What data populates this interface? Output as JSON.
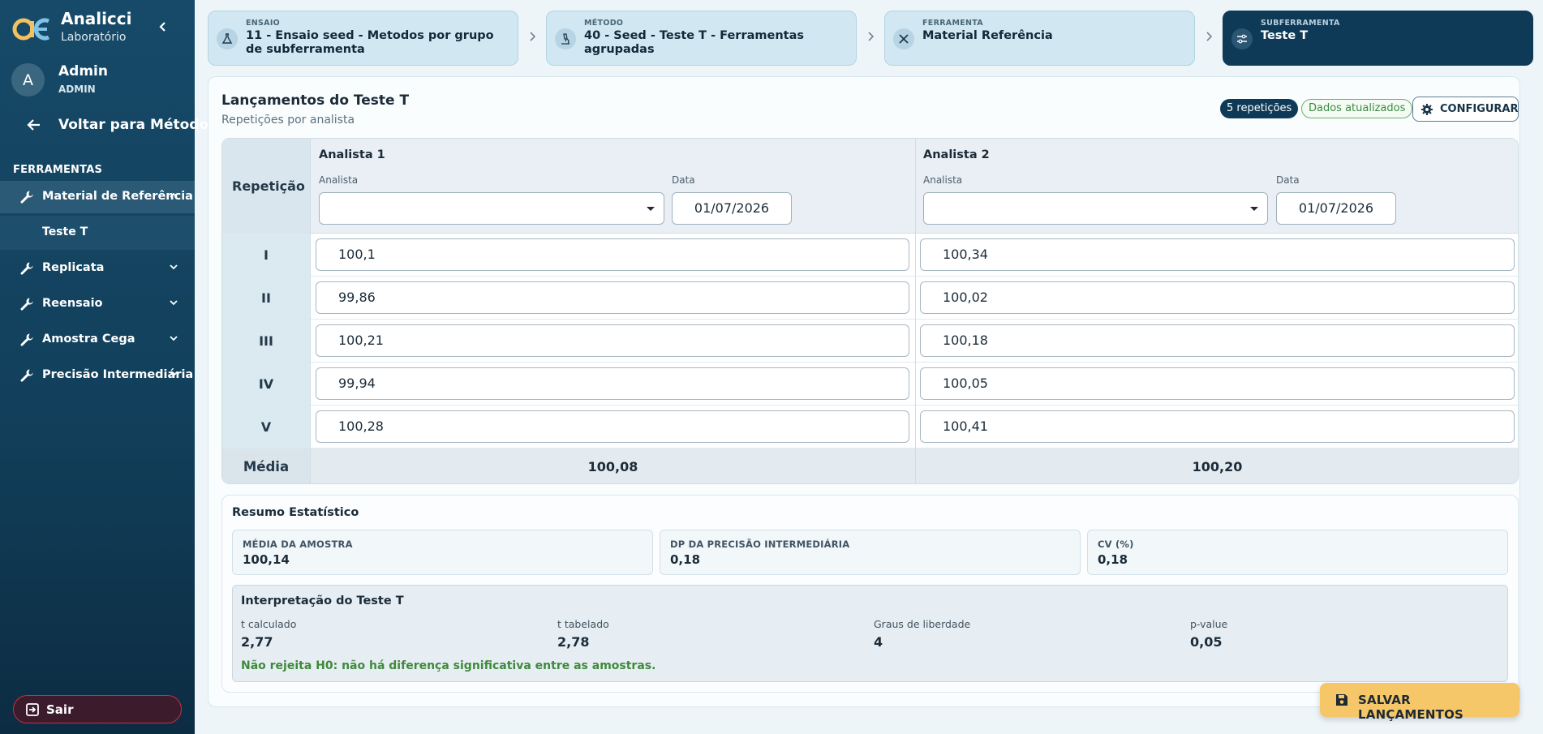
{
  "brand": {
    "name": "Analicci",
    "sub": "Laboratório"
  },
  "user": {
    "initial": "A",
    "name": "Admin",
    "role": "ADMIN"
  },
  "sidebar": {
    "back_label": "Voltar para Métodos",
    "section_title": "FERRAMENTAS",
    "items": [
      {
        "label": "Material de Referência"
      },
      {
        "label": "Replicata"
      },
      {
        "label": "Reensaio"
      },
      {
        "label": "Amostra Cega"
      },
      {
        "label": "Precisão Intermediária"
      }
    ],
    "sub_item": "Teste T",
    "logout_label": "Sair"
  },
  "breadcrumb": [
    {
      "caption": "ENSAIO",
      "value": "11 - Ensaio seed - Metodos por grupo de subferramenta"
    },
    {
      "caption": "MÉTODO",
      "value": "40 - Seed - Teste T - Ferramentas agrupadas"
    },
    {
      "caption": "FERRAMENTA",
      "value": "Material Referência"
    },
    {
      "caption": "SUBFERRAMENTA",
      "value": "Teste T"
    }
  ],
  "main": {
    "title": "Lançamentos do Teste T",
    "subtitle": "Repetições por analista",
    "reps_badge": "5 repetições",
    "status_badge": "Dados atualizados",
    "config_label": "CONFIGURAR"
  },
  "table": {
    "rep_header": "Repetição",
    "analysts": [
      {
        "title": "Analista 1",
        "analyst_caption": "Analista",
        "analyst_value": "",
        "date_caption": "Data",
        "date_value": "01/07/2026"
      },
      {
        "title": "Analista 2",
        "analyst_caption": "Analista",
        "analyst_value": "",
        "date_caption": "Data",
        "date_value": "01/07/2026"
      }
    ],
    "rows": [
      {
        "rep": "I",
        "a1": "100,1",
        "a2": "100,34"
      },
      {
        "rep": "II",
        "a1": "99,86",
        "a2": "100,02"
      },
      {
        "rep": "III",
        "a1": "100,21",
        "a2": "100,18"
      },
      {
        "rep": "IV",
        "a1": "99,94",
        "a2": "100,05"
      },
      {
        "rep": "V",
        "a1": "100,28",
        "a2": "100,41"
      }
    ],
    "avg_label": "Média",
    "avg_a1": "100,08",
    "avg_a2": "100,20"
  },
  "stats": {
    "title": "Resumo Estatístico",
    "boxes": [
      {
        "caption": "MÉDIA DA AMOSTRA",
        "value": "100,14"
      },
      {
        "caption": "DP DA PRECISÃO INTERMEDIÁRIA",
        "value": "0,18"
      },
      {
        "caption": "CV (%)",
        "value": "0,18"
      }
    ],
    "interp_title": "Interpretação do Teste T",
    "metrics": [
      {
        "caption": "t calculado",
        "value": "2,77"
      },
      {
        "caption": "t tabelado",
        "value": "2,78"
      },
      {
        "caption": "Graus de liberdade",
        "value": "4"
      },
      {
        "caption": "p-value",
        "value": "0,05"
      }
    ],
    "conclusion": "Não rejeita H0: não há diferença significativa entre as amostras."
  },
  "save_label": "SALVAR LANÇAMENTOS",
  "colors": {
    "sidebar": "#12405c",
    "accent": "#0f3a57",
    "save": "#f6c768",
    "success": "#3e8a3a"
  }
}
